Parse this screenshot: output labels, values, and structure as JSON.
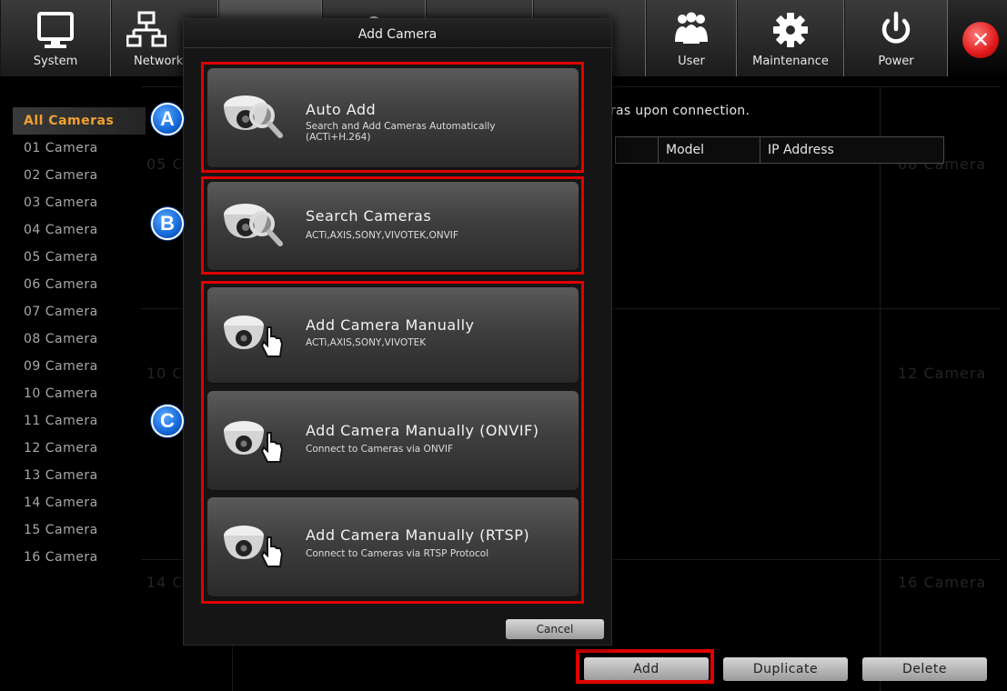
{
  "toolbar": {
    "items": [
      {
        "label": "System",
        "icon": "monitor-icon"
      },
      {
        "label": "Network",
        "icon": "network-icon"
      },
      {
        "label": "",
        "icon": "camera-tab-icon"
      },
      {
        "label": "",
        "icon": "event-icon"
      },
      {
        "label": "",
        "icon": "record-icon"
      },
      {
        "label": "",
        "icon": "storage-icon"
      },
      {
        "label": "User",
        "icon": "users-icon"
      },
      {
        "label": "Maintenance",
        "icon": "gear-icon"
      },
      {
        "label": "Power",
        "icon": "power-icon"
      }
    ],
    "close_icon": "close-icon",
    "close_glyph": "✕"
  },
  "camera_list": {
    "items": [
      "All Cameras",
      "01 Camera",
      "02 Camera",
      "03 Camera",
      "04 Camera",
      "05 Camera",
      "06 Camera",
      "07 Camera",
      "08 Camera",
      "09 Camera",
      "10 Camera",
      "11 Camera",
      "12 Camera",
      "13 Camera",
      "14 Camera",
      "15 Camera",
      "16 Camera"
    ],
    "active_index": 0
  },
  "background": {
    "notice": "eras upon connection.",
    "table_headers": [
      "",
      "Model",
      "IP Address"
    ],
    "ghost_labels": [
      "05 C",
      "08 Camera",
      "10 C",
      "12 Camera",
      "14 C",
      "16 Camera"
    ]
  },
  "bottom_buttons": {
    "add": "Add",
    "duplicate": "Duplicate",
    "delete": "Delete"
  },
  "dialog": {
    "title": "Add Camera",
    "options": [
      {
        "title": "Auto Add",
        "subtitle": "Search and Add Cameras Automatically\n(ACTi+H.264)",
        "icon": "search-camera-icon"
      },
      {
        "title": "Search Cameras",
        "subtitle": "ACTi,AXIS,SONY,VIVOTEK,ONVIF",
        "icon": "search-camera-icon"
      },
      {
        "title": "Add Camera Manually",
        "subtitle": "ACTi,AXIS,SONY,VIVOTEK",
        "icon": "camera-hand-icon"
      },
      {
        "title": "Add Camera Manually (ONVIF)",
        "subtitle": "Connect to Cameras via ONVIF",
        "icon": "camera-hand-icon"
      },
      {
        "title": "Add Camera Manually (RTSP)",
        "subtitle": "Connect to Cameras via RTSP Protocol",
        "icon": "camera-hand-icon"
      }
    ],
    "cancel": "Cancel"
  },
  "annotations": {
    "markers": [
      "A",
      "B",
      "C"
    ],
    "highlight_color": "#e00000",
    "marker_color": "#1468d8"
  }
}
